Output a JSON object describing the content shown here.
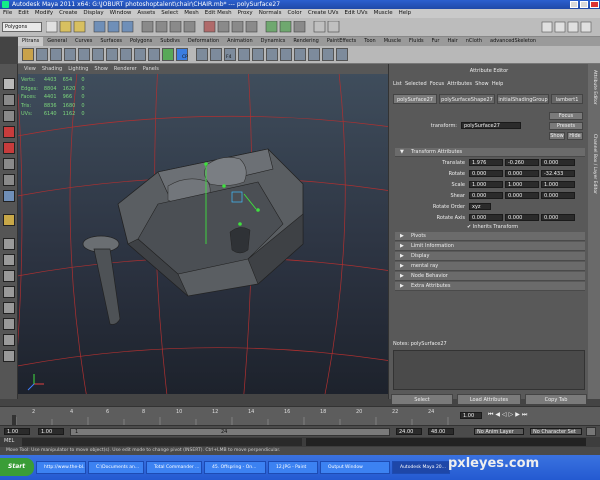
{
  "window": {
    "title": "Autodesk Maya 2011 x64: G:\\JOBURT photoshoptalent\\chair\\CHAIR.mb* --- polySurface27"
  },
  "menubar": {
    "items": [
      "File",
      "Edit",
      "Modify",
      "Create",
      "Display",
      "Window",
      "Assets",
      "Select",
      "Mesh",
      "Edit Mesh",
      "Proxy",
      "Normals",
      "Color",
      "Create UVs",
      "Edit UVs",
      "Muscle",
      "Help"
    ]
  },
  "status_line": {
    "mode": "Polygons"
  },
  "shelf": {
    "tabs": [
      "Pltrans",
      "General",
      "Curves",
      "Surfaces",
      "Polygons",
      "Subdivs",
      "Deformation",
      "Animation",
      "Dynamics",
      "Rendering",
      "PaintEffects",
      "Toon",
      "Muscle",
      "Fluids",
      "Fur",
      "Hair",
      "nCloth",
      "advancedSkeleton"
    ],
    "active_tab": "Pltrans",
    "icon_labels": [
      "CP",
      "F4"
    ]
  },
  "viewport": {
    "menu": [
      "View",
      "Shading",
      "Lighting",
      "Show",
      "Renderer",
      "Panels"
    ],
    "hud": [
      {
        "label": "Verts:",
        "a": "4403",
        "b": "654",
        "c": "0"
      },
      {
        "label": "Edges:",
        "a": "8804",
        "b": "1620",
        "c": "0"
      },
      {
        "label": "Faces:",
        "a": "4401",
        "b": "966",
        "c": "0"
      },
      {
        "label": "Tris:",
        "a": "8836",
        "b": "1680",
        "c": "0"
      },
      {
        "label": "UVs:",
        "a": "6140",
        "b": "1162",
        "c": "0"
      }
    ]
  },
  "attribute_editor": {
    "title": "Attribute Editor",
    "menu": [
      "List",
      "Selected",
      "Focus",
      "Attributes",
      "Show",
      "Help"
    ],
    "tabs": [
      "polySurface27",
      "polySurfaceShape27",
      "initialShadingGroup",
      "lambert1"
    ],
    "transform_label": "transform:",
    "transform_value": "polySurface27",
    "side_buttons": [
      "Focus",
      "Presets",
      "Show",
      "Hide"
    ],
    "section": "Transform Attributes",
    "rows": [
      {
        "label": "Translate",
        "values": [
          "1.976",
          "-0.260",
          "0.000"
        ]
      },
      {
        "label": "Rotate",
        "values": [
          "0.000",
          "0.000",
          "-32.433"
        ]
      },
      {
        "label": "Scale",
        "values": [
          "1.000",
          "1.000",
          "1.000"
        ]
      },
      {
        "label": "Shear",
        "values": [
          "0.000",
          "0.000",
          "0.000"
        ]
      }
    ],
    "rotate_order_label": "Rotate Order",
    "rotate_order_value": "xyz",
    "rotate_axis_label": "Rotate Axis",
    "rotate_axis_values": [
      "0.000",
      "0.000",
      "0.000"
    ],
    "inherits_transform": "Inherits Transform",
    "frames": [
      "Pivots",
      "Limit Information",
      "Display",
      "mental ray",
      "Node Behavior",
      "Extra Attributes"
    ],
    "notes_label": "Notes: polySurface27",
    "bottom_buttons": [
      "Select",
      "Load Attributes",
      "Copy Tab"
    ]
  },
  "side_tabs": [
    "Attribute Editor",
    "Channel Box / Layer Editor"
  ],
  "time_slider": {
    "ticks": [
      "2",
      "4",
      "6",
      "8",
      "10",
      "12",
      "14",
      "16",
      "18",
      "20",
      "22",
      "24"
    ],
    "current_frame": "1.00"
  },
  "range_slider": {
    "start": "1.00",
    "inner_start": "1.00",
    "range_start": "1",
    "range_end": "24",
    "end": "24.00",
    "anim_end": "48.00",
    "anim_layer": "No Anim Layer",
    "character_set": "No Character Set"
  },
  "command_line": {
    "label": "MEL"
  },
  "help_line": {
    "text": "Move Tool: Use manipulator to move object(s). Use edit mode to change pivot (INSERT). Ctrl+LMB to move perpendicular."
  },
  "taskbar": {
    "start": "Start",
    "tasks": [
      "http://www.the-bl...",
      "C:\\Documents an...",
      "Total Commander ...",
      "45. Offspring - On...",
      "12.JPG - Paint",
      "Output Window",
      "Autodesk Maya 20..."
    ]
  },
  "watermark": "pxleyes.com",
  "colors": {
    "titlebar": "#2356c4",
    "taskbar": "#2a62da",
    "hud_text": "#7cd77c",
    "grid": "#b03030"
  }
}
